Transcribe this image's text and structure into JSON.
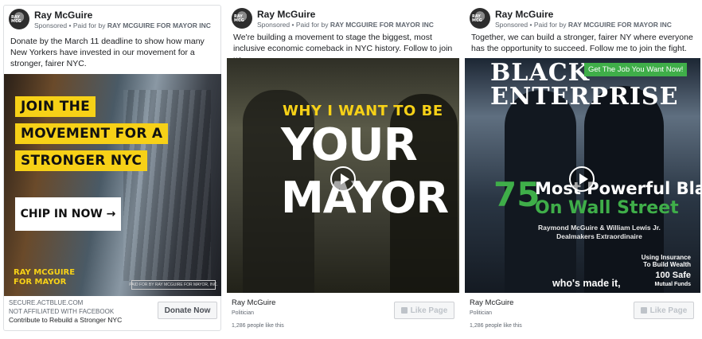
{
  "ads": [
    {
      "page_name": "Ray McGuire",
      "sponsored": "Sponsored",
      "paid_for_prefix": "Paid for by",
      "paid_for_by": "RAY MCGUIRE FOR MAYOR INC",
      "avatar_text": "RAY MCG",
      "text": "Donate by the March 11 deadline to show how many New Yorkers have invested in our movement for a stronger, fairer NYC.",
      "creative": {
        "headline_lines": [
          "JOIN THE",
          "MOVEMENT FOR A",
          "STRONGER NYC"
        ],
        "cta_overlay": "CHIP IN NOW →",
        "logo_lines": [
          "RAY MCGUIRE",
          "FOR MAYOR"
        ],
        "paid_box": "PAID FOR BY RAY MCGUIRE FOR MAYOR, INC."
      },
      "footer": {
        "domain": "SECURE.ACTBLUE.COM",
        "notice": "NOT AFFILIATED WITH FACEBOOK",
        "description": "Contribute to Rebuild a Stronger NYC"
      },
      "button": "Donate Now"
    },
    {
      "page_name": "Ray McGuire",
      "sponsored": "Sponsored",
      "paid_for_prefix": "Paid for by",
      "paid_for_by": "RAY MCGUIRE FOR MAYOR INC",
      "avatar_text": "RAY MCG",
      "text": "We're building a movement to stage the biggest, most inclusive economic comeback in NYC history. Follow to join us.",
      "creative": {
        "small_line": "WHY I WANT TO BE",
        "big_lines": [
          "YOUR",
          "MAYOR"
        ]
      },
      "footer": {
        "page_name": "Ray McGuire",
        "category": "Politician",
        "likes": "1,286 people like this"
      },
      "button": "Like Page"
    },
    {
      "page_name": "Ray McGuire",
      "sponsored": "Sponsored",
      "paid_for_prefix": "Paid for by",
      "paid_for_by": "RAY MCGUIRE FOR MAYOR INC",
      "avatar_text": "RAY MCG",
      "text": "Together, we can build a stronger, fairer NY where everyone has the opportunity to succeed. Follow me to join the fight.",
      "creative": {
        "masthead_lines": [
          "BLACK",
          "ENTERPRISE"
        ],
        "badge": "Get The Job You Want Now!",
        "number": "75",
        "headline_lines": [
          "Most Powerful Blacks",
          "On Wall Street"
        ],
        "names_lines": [
          "Raymond McGuire & William Lewis Jr.",
          "Dealmakers Extraordinaire"
        ],
        "side1_lines": [
          "Using Insurance",
          "To Build Wealth"
        ],
        "side2_lines": [
          "100 Safe",
          "Mutual Funds"
        ],
        "caption": "who's made it,"
      },
      "footer": {
        "page_name": "Ray McGuire",
        "category": "Politician",
        "likes": "1,286 people like this"
      },
      "button": "Like Page"
    }
  ],
  "colors": {
    "yellow": "#f7d117",
    "green": "#3fae49",
    "text": "#1c1e21",
    "muted": "#606770"
  }
}
